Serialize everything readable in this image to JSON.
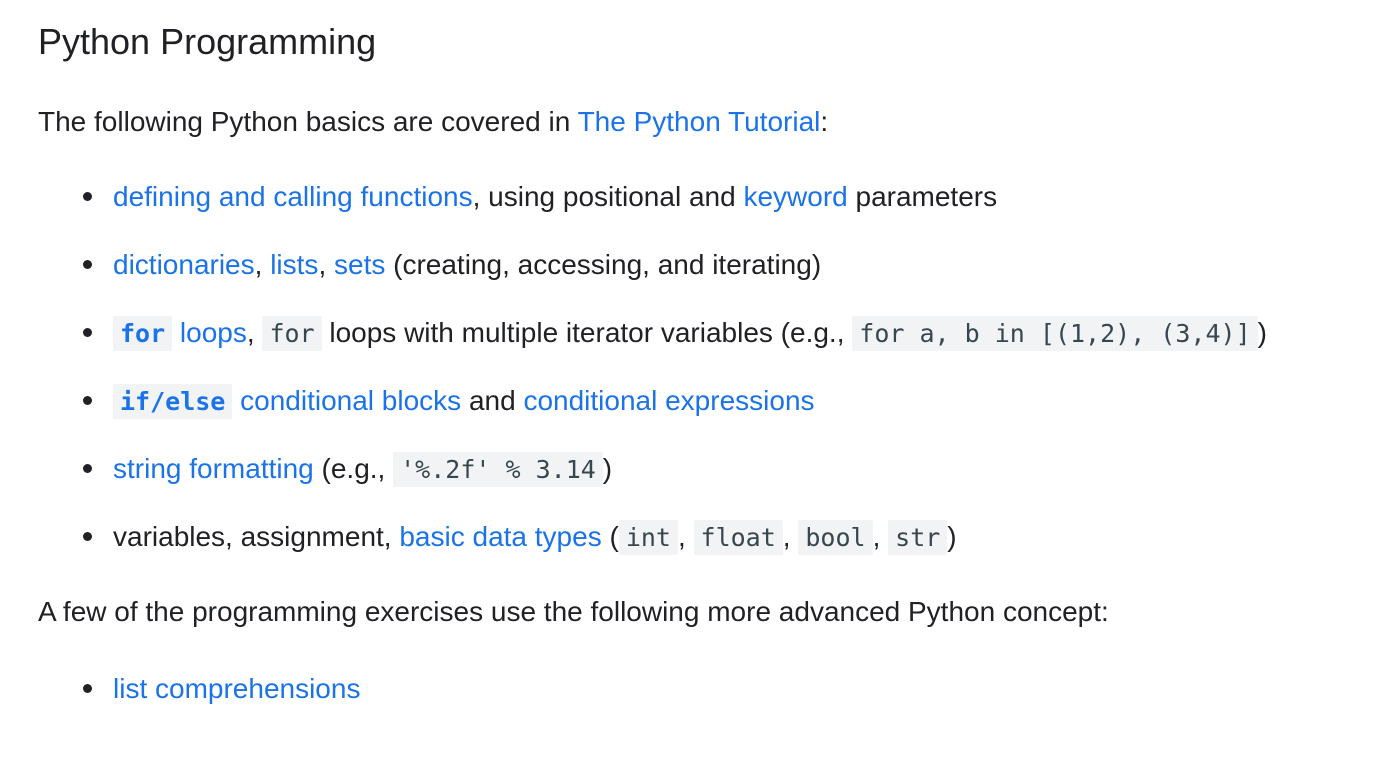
{
  "title": "Python Programming",
  "intro": {
    "text": "The following Python basics are covered in ",
    "link": "The Python Tutorial",
    "suffix": ":"
  },
  "basics": {
    "item1": {
      "link1": "defining and calling functions",
      "text1": ", using positional and ",
      "link2": "keyword",
      "text2": " parameters"
    },
    "item2": {
      "link1": "dictionaries",
      "sep1": ", ",
      "link2": "lists",
      "sep2": ", ",
      "link3": "sets",
      "text": " (creating, accessing, and iterating)"
    },
    "item3": {
      "code_link": "for",
      "link": " loops",
      "sep": ", ",
      "code": "for",
      "text": " loops with multiple iterator variables (e.g., ",
      "code2": "for a, b in [(1,2), (3,4)]",
      "end": ")"
    },
    "item4": {
      "code_link": "if/else",
      "link1": " conditional blocks",
      "text": " and ",
      "link2": "conditional expressions"
    },
    "item5": {
      "link": "string formatting",
      "text": " (e.g., ",
      "code": "'%.2f' % 3.14",
      "end": ")"
    },
    "item6": {
      "text": "variables, assignment, ",
      "link": "basic data types",
      "open": " (",
      "code1": "int",
      "sep1": ", ",
      "code2": "float",
      "sep2": ", ",
      "code3": "bool",
      "sep3": ", ",
      "code4": "str",
      "end": ")"
    }
  },
  "advanced_intro": "A few of the programming exercises use the following more advanced Python concept:",
  "advanced": {
    "item1": {
      "link": "list comprehensions"
    }
  }
}
